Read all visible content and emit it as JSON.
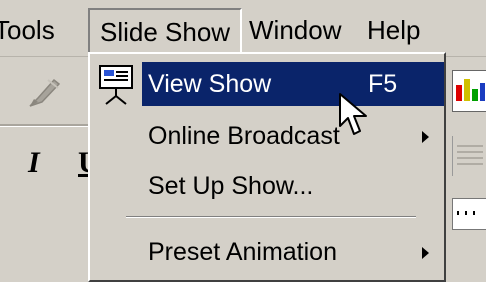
{
  "menubar": {
    "tools": "Tools",
    "slide_show": "Slide Show",
    "window": "Window",
    "help": "Help"
  },
  "dropdown": {
    "items": [
      {
        "label": "View Show",
        "shortcut": "F5",
        "highlighted": true
      },
      {
        "label": "Online Broadcast",
        "submenu": true
      },
      {
        "label": "Set Up Show..."
      },
      {
        "label": "Preset Animation",
        "submenu": true
      }
    ]
  },
  "colors": {
    "menu_bg": "#d4d0c8",
    "highlight_bg": "#0a246a",
    "highlight_text": "#ffffff"
  },
  "icons": {
    "view_show": "projector-screen-icon",
    "pen": "pen-icon",
    "cursor": "arrow-cursor-icon"
  }
}
